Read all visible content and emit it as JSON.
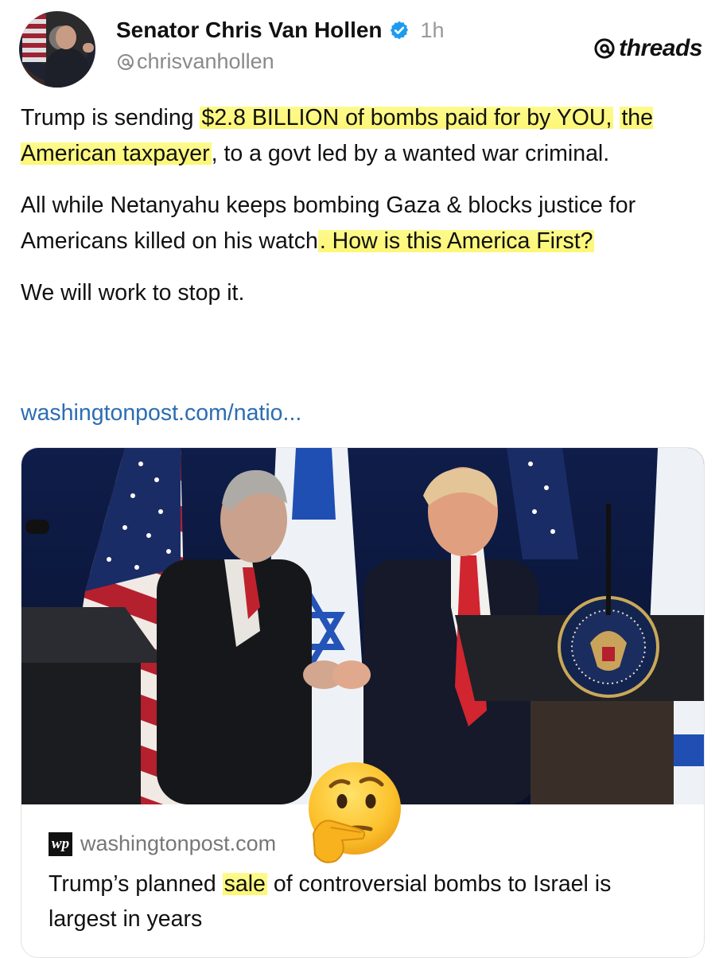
{
  "post": {
    "author_name": "Senator Chris Van Hollen",
    "time": "1h",
    "handle": "chrisvanhollen",
    "handle_prefix_icon": "threads-at-icon",
    "brand": "threads",
    "paragraph1": {
      "before": "Trump is sending ",
      "hl1": "$2.8 BILLION of bombs paid for by YOU,",
      "hl2": "the American taxpayer",
      "after": ", to a govt led by a wanted war criminal."
    },
    "paragraph2": {
      "before": "All while Netanyahu keeps bombing Gaza & blocks justice for Americans killed on his watch",
      "hl": ". How is this America First?"
    },
    "paragraph3": "We will work to stop it.",
    "link_text": "washingtonpost.com/natio..."
  },
  "card": {
    "source_logo_text": "wp",
    "source": "washingtonpost.com",
    "title_before": "Trump’s planned ",
    "title_hl": "sale",
    "title_after": " of controversial bombs to Israel is largest in years"
  },
  "colors": {
    "highlight": "#fdf676",
    "link": "#2c6db3",
    "verified": "#1d9bf0"
  },
  "overlay": {
    "emoji": "thinking-face"
  }
}
